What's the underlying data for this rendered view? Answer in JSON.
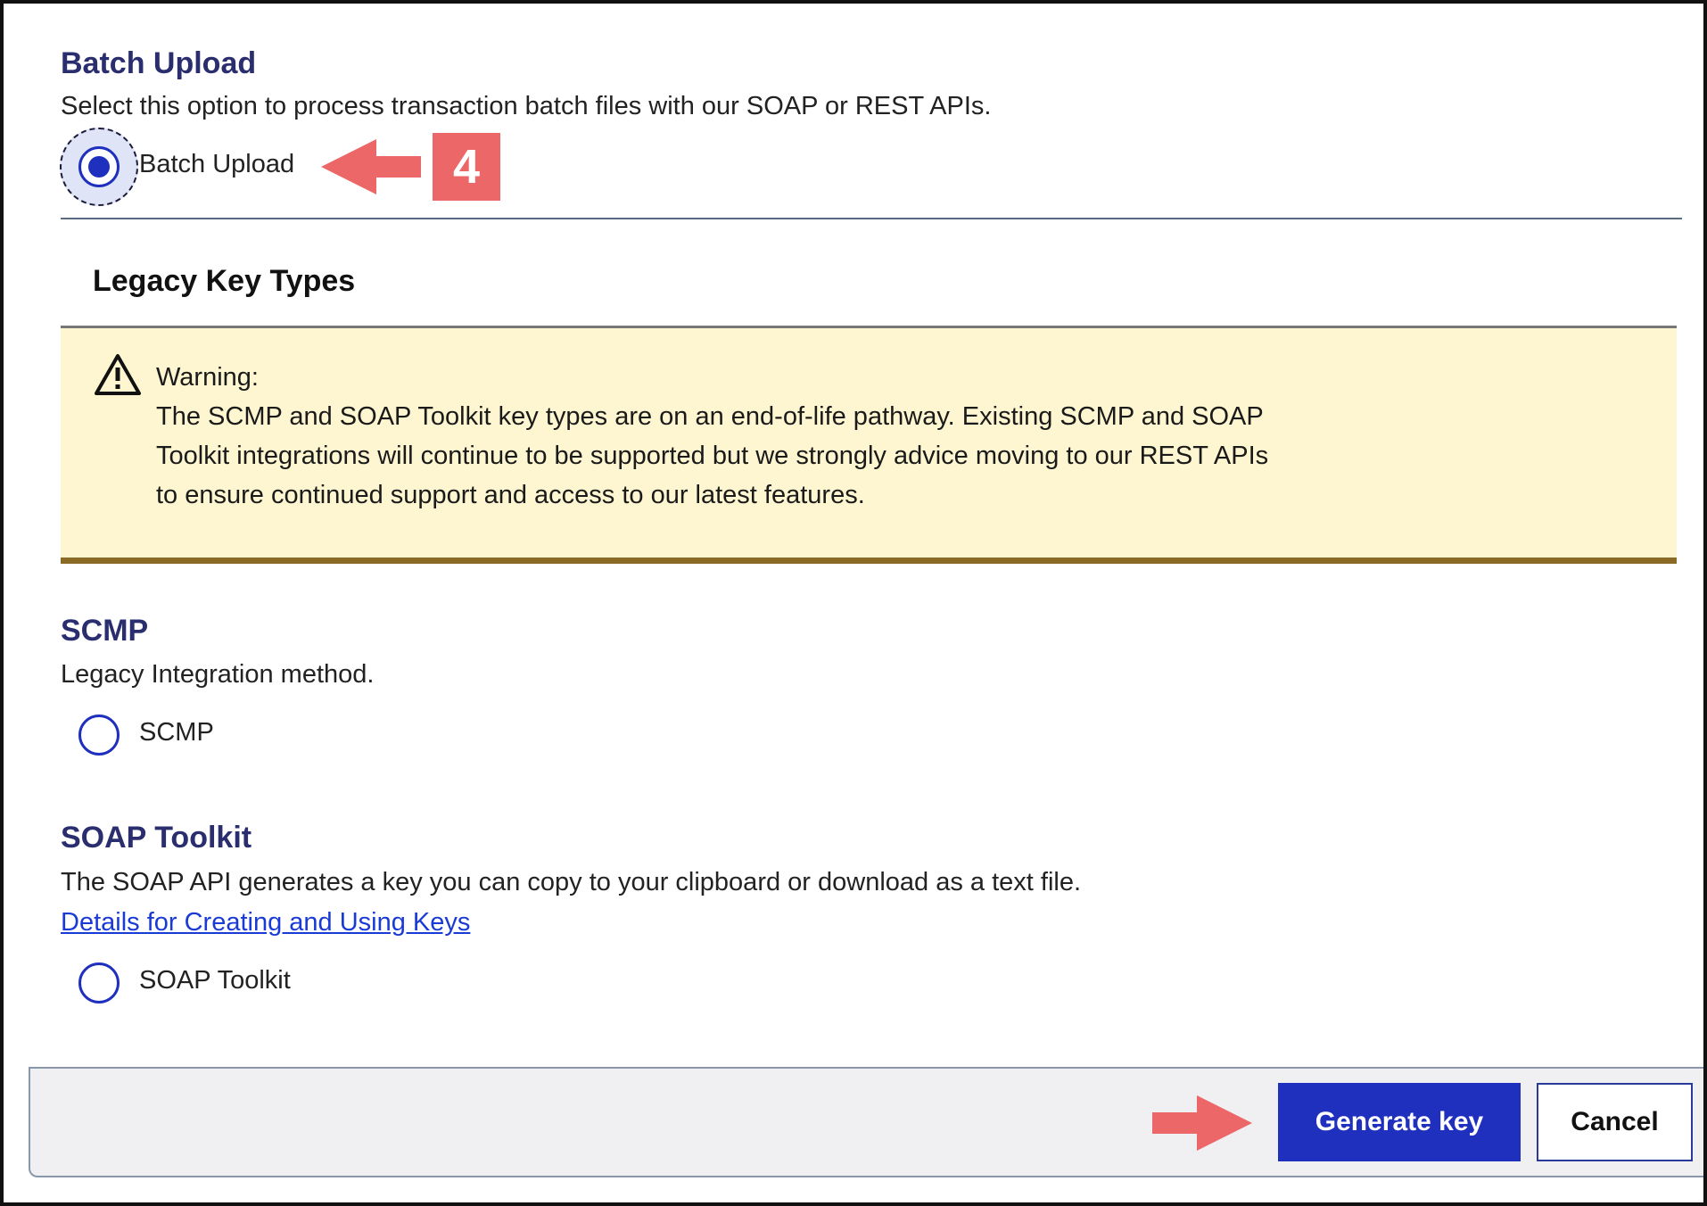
{
  "batch_upload": {
    "title": "Batch Upload",
    "description": "Select this option to process transaction batch files with our SOAP or REST APIs.",
    "radio_label": "Batch Upload",
    "checked": true
  },
  "legacy": {
    "title": "Legacy Key Types",
    "warning": {
      "heading": "Warning:",
      "lines": [
        "The SCMP and SOAP Toolkit key types are on an end-of-life pathway. Existing SCMP and SOAP",
        "Toolkit integrations will continue to be supported but we strongly advice moving to our REST APIs",
        "to ensure continued support and access to our latest features."
      ]
    }
  },
  "scmp": {
    "title": "SCMP",
    "description": "Legacy Integration method.",
    "radio_label": "SCMP"
  },
  "soap": {
    "title": "SOAP Toolkit",
    "description": "The SOAP API generates a key you can copy to your clipboard or download as a text file.",
    "link": "Details for Creating and Using Keys",
    "radio_label": "SOAP Toolkit"
  },
  "footer": {
    "generate_label": "Generate key",
    "cancel_label": "Cancel"
  },
  "annotation": {
    "step_number": "4",
    "color": "#ec6868"
  },
  "colors": {
    "accent": "#1f2fbe",
    "heading": "#2a2e6e",
    "warning_bg": "#fdf6d0",
    "warning_border": "#8a6a24",
    "link": "#1a3ad6"
  }
}
